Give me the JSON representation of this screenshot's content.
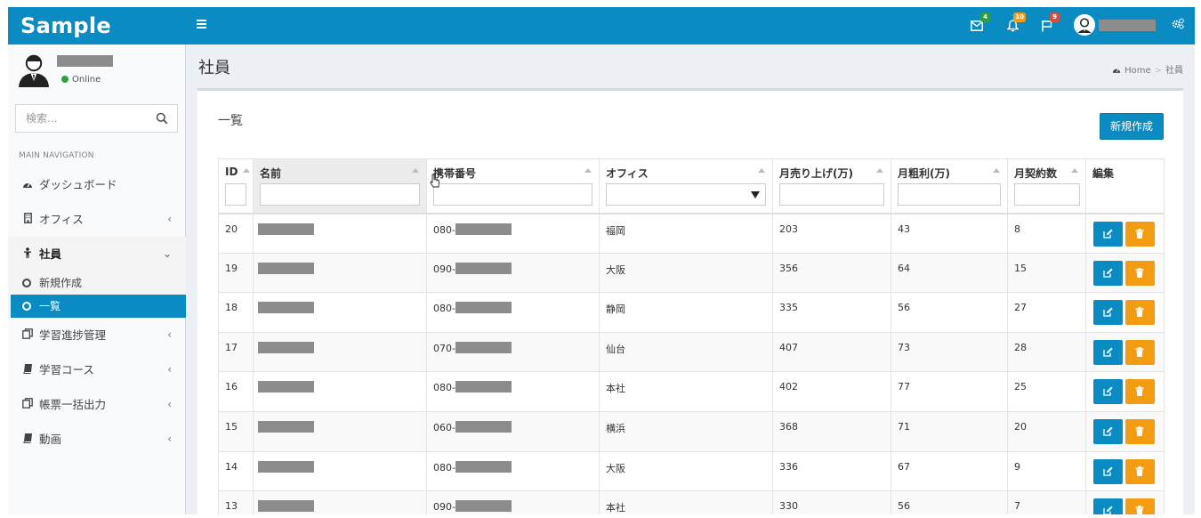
{
  "header": {
    "logo": "Sample",
    "badges": {
      "mail": "4",
      "bell": "10",
      "flag": "9"
    },
    "colors": {
      "primary": "#0a8bc2",
      "mail_badge": "#2ea043",
      "bell_badge": "#f39c12",
      "flag_badge": "#dd4b39"
    }
  },
  "sidebar": {
    "user_status": "Online",
    "search_placeholder": "検索...",
    "nav_header": "MAIN NAVIGATION",
    "items": [
      {
        "label": "ダッシュボード",
        "icon": "dashboard-icon"
      },
      {
        "label": "オフィス",
        "icon": "building-icon"
      },
      {
        "label": "社員",
        "icon": "person-icon"
      },
      {
        "label": "学習進捗管理",
        "icon": "copy-icon"
      },
      {
        "label": "学習コース",
        "icon": "book-icon"
      },
      {
        "label": "帳票一括出力",
        "icon": "copy-icon"
      },
      {
        "label": "動画",
        "icon": "book-icon"
      }
    ],
    "sub_items": [
      {
        "label": "新規作成"
      },
      {
        "label": "一覧"
      }
    ]
  },
  "page": {
    "title": "社員",
    "breadcrumb": {
      "home": "Home",
      "current": "社員"
    },
    "box_title": "一覧",
    "new_button": "新規作成"
  },
  "table": {
    "columns": [
      "ID",
      "名前",
      "携帯番号",
      "オフィス",
      "月売り上げ(万)",
      "月粗利(万)",
      "月契約数",
      "編集"
    ],
    "rows": [
      {
        "id": "20",
        "phone_prefix": "080-",
        "office": "福岡",
        "sales": "203",
        "profit": "43",
        "contracts": "8"
      },
      {
        "id": "19",
        "phone_prefix": "090-",
        "office": "大阪",
        "sales": "356",
        "profit": "64",
        "contracts": "15"
      },
      {
        "id": "18",
        "phone_prefix": "080-",
        "office": "静岡",
        "sales": "335",
        "profit": "56",
        "contracts": "27"
      },
      {
        "id": "17",
        "phone_prefix": "070-",
        "office": "仙台",
        "sales": "407",
        "profit": "73",
        "contracts": "28"
      },
      {
        "id": "16",
        "phone_prefix": "080-",
        "office": "本社",
        "sales": "402",
        "profit": "77",
        "contracts": "25"
      },
      {
        "id": "15",
        "phone_prefix": "060-",
        "office": "横浜",
        "sales": "368",
        "profit": "71",
        "contracts": "20"
      },
      {
        "id": "14",
        "phone_prefix": "080-",
        "office": "大阪",
        "sales": "336",
        "profit": "67",
        "contracts": "9"
      },
      {
        "id": "13",
        "phone_prefix": "090-",
        "office": "本社",
        "sales": "330",
        "profit": "56",
        "contracts": "7"
      }
    ]
  }
}
